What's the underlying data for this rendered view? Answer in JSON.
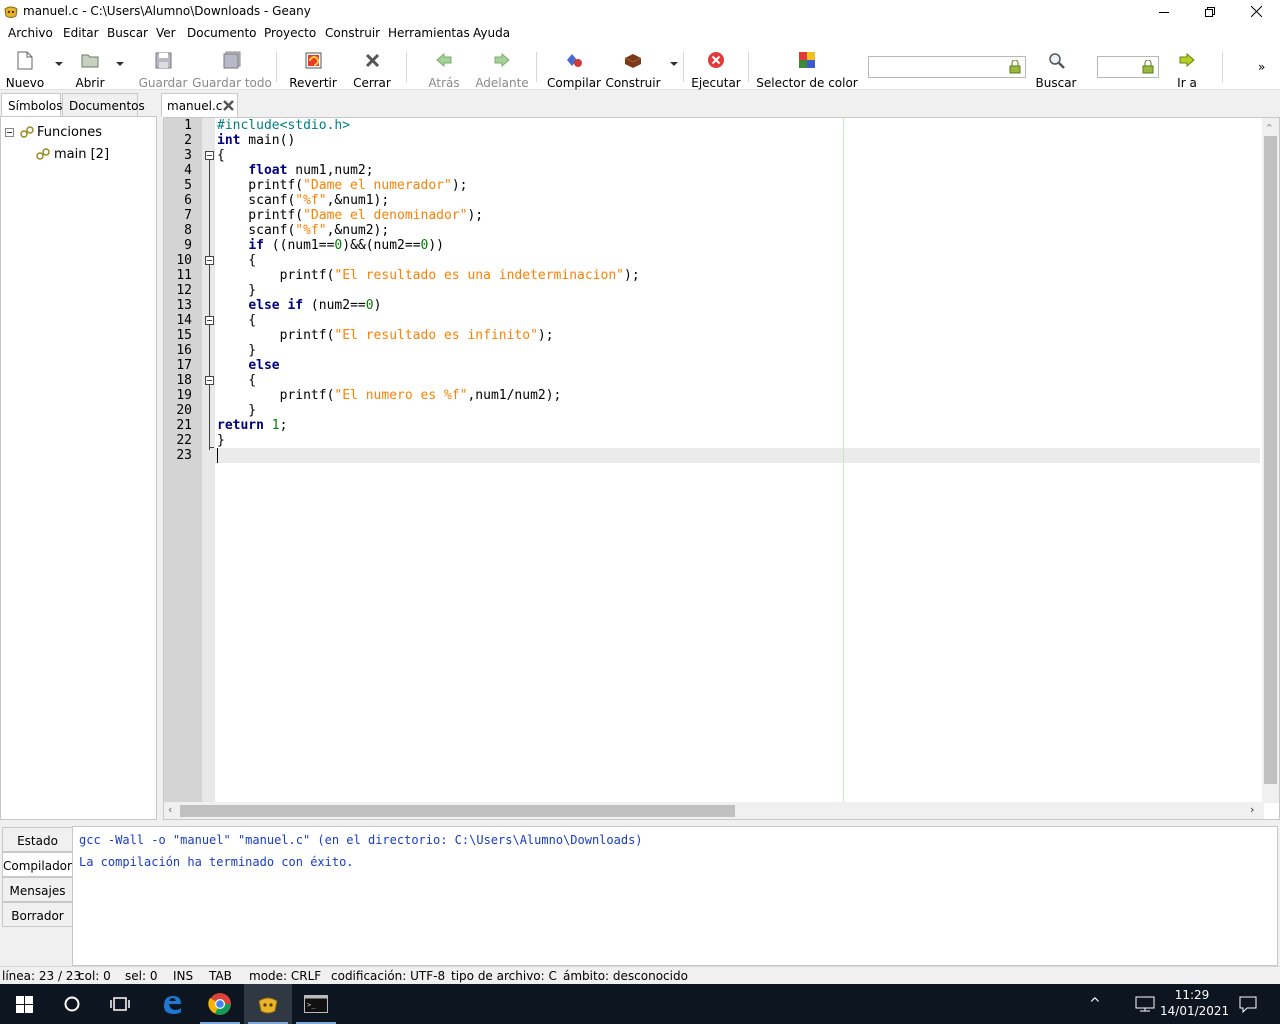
{
  "window": {
    "title": "manuel.c - C:\\Users\\Alumno\\Downloads - Geany"
  },
  "menu": [
    "Archivo",
    "Editar",
    "Buscar",
    "Ver",
    "Documento",
    "Proyecto",
    "Construir",
    "Herramientas",
    "Ayuda"
  ],
  "toolbar": {
    "nuevo": "Nuevo",
    "abrir": "Abrir",
    "guardar": "Guardar",
    "guardar_todo": "Guardar todo",
    "revertir": "Revertir",
    "cerrar": "Cerrar",
    "atras": "Atrás",
    "adelante": "Adelante",
    "compilar": "Compilar",
    "construir": "Construir",
    "ejecutar": "Ejecutar",
    "selector_color": "Selector de color",
    "buscar": "Buscar",
    "ir_a": "Ir a",
    "search_value": "",
    "goto_value": ""
  },
  "sidebar": {
    "tabs": [
      "Símbolos",
      "Documentos"
    ],
    "tree": {
      "root": "Funciones",
      "child": "main [2]"
    }
  },
  "document_tab": "manuel.c",
  "editor": {
    "line_numbers": [
      "1",
      "2",
      "3",
      "4",
      "5",
      "6",
      "7",
      "8",
      "9",
      "10",
      "11",
      "12",
      "13",
      "14",
      "15",
      "16",
      "17",
      "18",
      "19",
      "20",
      "21",
      "22",
      "23"
    ],
    "code": [
      [
        [
          "pp",
          "#include<stdio.h>"
        ]
      ],
      [
        [
          "kw",
          "int"
        ],
        [
          "t",
          " main()"
        ]
      ],
      [
        [
          "t",
          "{"
        ]
      ],
      [
        [
          "t",
          "    "
        ],
        [
          "kw",
          "float"
        ],
        [
          "t",
          " num1,num2;"
        ]
      ],
      [
        [
          "t",
          "    printf("
        ],
        [
          "s",
          "\"Dame el numerador\""
        ],
        [
          "t",
          ");"
        ]
      ],
      [
        [
          "t",
          "    scanf("
        ],
        [
          "s",
          "\"%f\""
        ],
        [
          "t",
          ",&num1);"
        ]
      ],
      [
        [
          "t",
          "    printf("
        ],
        [
          "s",
          "\"Dame el denominador\""
        ],
        [
          "t",
          ");"
        ]
      ],
      [
        [
          "t",
          "    scanf("
        ],
        [
          "s",
          "\"%f\""
        ],
        [
          "t",
          ",&num2);"
        ]
      ],
      [
        [
          "t",
          "    "
        ],
        [
          "kw",
          "if"
        ],
        [
          "t",
          " ((num1=="
        ],
        [
          "n",
          "0"
        ],
        [
          "t",
          ")&&(num2=="
        ],
        [
          "n",
          "0"
        ],
        [
          "t",
          "))"
        ]
      ],
      [
        [
          "t",
          "    {"
        ]
      ],
      [
        [
          "t",
          "        printf("
        ],
        [
          "s",
          "\"El resultado es una indeterminacion\""
        ],
        [
          "t",
          ");"
        ]
      ],
      [
        [
          "t",
          "    }"
        ]
      ],
      [
        [
          "t",
          "    "
        ],
        [
          "kw",
          "else if"
        ],
        [
          "t",
          " (num2=="
        ],
        [
          "n",
          "0"
        ],
        [
          "t",
          ")"
        ]
      ],
      [
        [
          "t",
          "    {"
        ]
      ],
      [
        [
          "t",
          "        printf("
        ],
        [
          "s",
          "\"El resultado es infinito\""
        ],
        [
          "t",
          ");"
        ]
      ],
      [
        [
          "t",
          "    }"
        ]
      ],
      [
        [
          "t",
          "    "
        ],
        [
          "kw",
          "else"
        ]
      ],
      [
        [
          "t",
          "    {"
        ]
      ],
      [
        [
          "t",
          "        printf("
        ],
        [
          "s",
          "\"El numero es %f\""
        ],
        [
          "t",
          ",num1/num2);"
        ]
      ],
      [
        [
          "t",
          "    }"
        ]
      ],
      [
        [
          "kw",
          "return"
        ],
        [
          "t",
          " "
        ],
        [
          "n",
          "1"
        ],
        [
          "t",
          ";"
        ]
      ],
      [
        [
          "t",
          "}"
        ]
      ],
      [
        [
          "t",
          ""
        ]
      ]
    ]
  },
  "messages": {
    "tabs": [
      "Estado",
      "Compilador",
      "Mensajes",
      "Borrador"
    ],
    "active_tab": "Compilador",
    "lines": [
      "gcc -Wall -o \"manuel\" \"manuel.c\" (en el directorio: C:\\Users\\Alumno\\Downloads)",
      "La compilación ha terminado con éxito."
    ]
  },
  "status": {
    "linea": "línea: 23 / 23",
    "col": "col: 0",
    "sel": "sel: 0",
    "ins": "INS",
    "tab": "TAB",
    "mode": "mode: CRLF",
    "codificacion": "codificación: UTF-8",
    "tipo": "tipo de archivo: C",
    "ambito": "ámbito: desconocido"
  },
  "taskbar": {
    "time": "11:29",
    "date": "14/01/2021"
  },
  "colors": {
    "keyword": "#000080",
    "string": "#ff8000",
    "number": "#007f00",
    "preprocessor": "#007f7f",
    "plain": "#000000",
    "messages": "#1a3cc6"
  }
}
